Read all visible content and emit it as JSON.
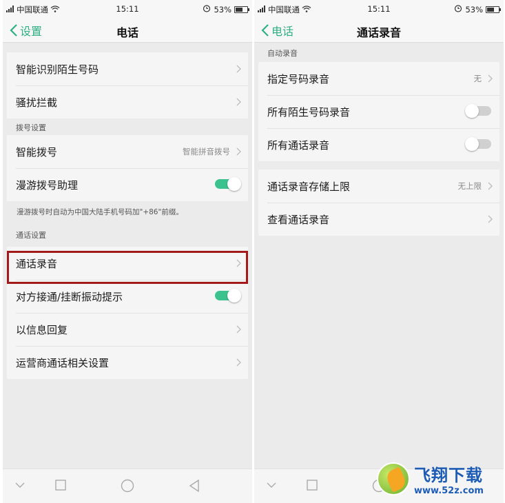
{
  "status_bar": {
    "carrier": "中国联通",
    "time": "15:11",
    "battery": "53%",
    "battery_level": 0.53,
    "icons": [
      "signal-icon",
      "wifi-icon",
      "alarm-icon",
      "battery-icon"
    ]
  },
  "left_screen": {
    "back_label": "设置",
    "title": "电话",
    "group1": [
      {
        "label": "智能识别陌生号码"
      },
      {
        "label": "骚扰拦截"
      }
    ],
    "dial_section_label": "拨号设置",
    "dial_group": [
      {
        "label": "智能拨号",
        "value": "智能拼音拨号"
      },
      {
        "label": "漫游拨号助理",
        "toggle": true
      }
    ],
    "roaming_hint": "漫游拨号时自动为中国大陆手机号码加\"+86\"前缀。",
    "call_section_label": "通话设置",
    "call_group": [
      {
        "label": "通话录音",
        "highlighted": true
      },
      {
        "label": "对方接通/挂断振动提示",
        "toggle": true
      },
      {
        "label": "以信息回复"
      },
      {
        "label": "运营商通话相关设置"
      }
    ]
  },
  "right_screen": {
    "back_label": "电话",
    "title": "通话录音",
    "auto_section_label": "自动录音",
    "auto_group": [
      {
        "label": "指定号码录音",
        "value": "无"
      },
      {
        "label": "所有陌生号码录音",
        "toggle": false
      },
      {
        "label": "所有通话录音",
        "toggle": false
      }
    ],
    "storage_group": [
      {
        "label": "通话录音存储上限",
        "value": "无上限"
      },
      {
        "label": "查看通话录音"
      }
    ]
  },
  "bottom_nav": {
    "icons": [
      "back-chevron-down-icon",
      "recents-square-icon",
      "home-circle-icon",
      "back-triangle-icon"
    ]
  },
  "watermark": {
    "title": "飞翔下载",
    "url": "www.52z.com"
  },
  "colors": {
    "accent": "#2fae84",
    "toggle_on": "#3cc28e",
    "highlight_border": "#a31a1a",
    "watermark_blue": "#1d5cb5"
  }
}
